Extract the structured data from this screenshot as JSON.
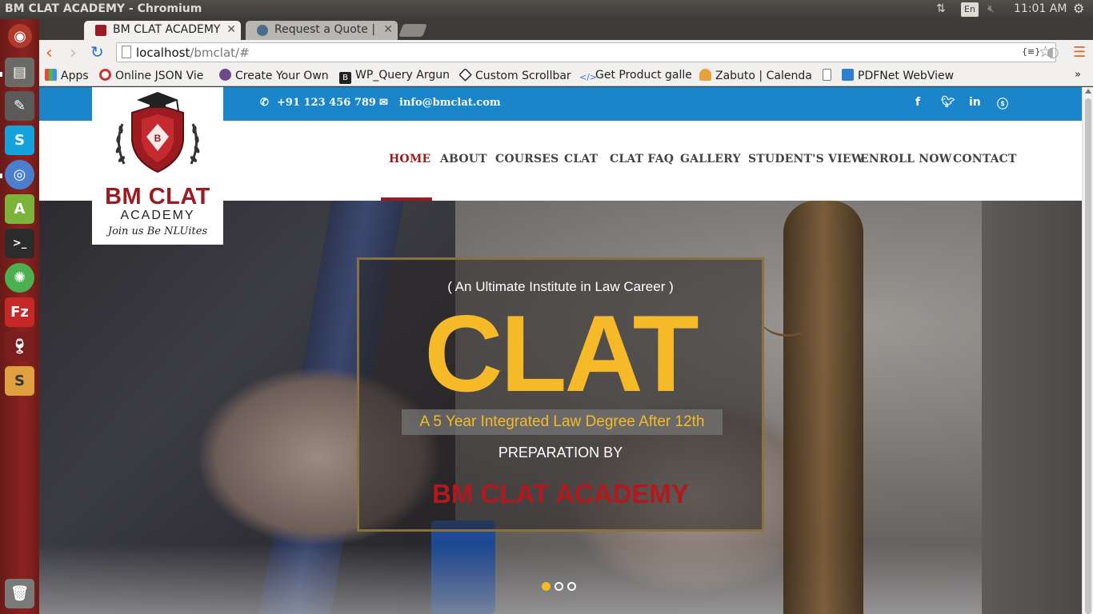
{
  "os": {
    "window_title": "BM CLAT ACADEMY - Chromium",
    "keyboard_layout": "En",
    "clock": "11:01 AM"
  },
  "browser": {
    "tabs": [
      {
        "title": "BM CLAT ACADEMY",
        "active": true
      },
      {
        "title": "Request a Quote | Tr",
        "active": false
      }
    ],
    "url_host": "localhost",
    "url_path": "/bmclat/#",
    "bookmarks": [
      {
        "label": "Apps",
        "icon": "apps-grid-icon"
      },
      {
        "label": "Online JSON Vie",
        "icon": "json-icon"
      },
      {
        "label": "Create Your Own",
        "icon": "feather-icon"
      },
      {
        "label": "WP_Query Argun",
        "icon": "b-icon"
      },
      {
        "label": "Custom Scrollbar",
        "icon": "codepen-icon"
      },
      {
        "label": "Get Product galle",
        "icon": "code-icon"
      },
      {
        "label": "Zabuto | Calenda",
        "icon": "calendar-icon"
      },
      {
        "label": "",
        "icon": "page-icon"
      },
      {
        "label": "PDFNet WebView",
        "icon": "pdfnet-icon"
      }
    ]
  },
  "site": {
    "phone": "+91 123 456 789",
    "email": "info@bmclat.com",
    "logo": {
      "name": "BM CLAT",
      "sub": "ACADEMY",
      "tagline": "Join us Be NLUites"
    },
    "nav": [
      "HOME",
      "ABOUT",
      "COURSES",
      "CLAT",
      "CLAT FAQ",
      "GALLERY",
      "STUDENT'S VIEW",
      "ENROLL NOW",
      "CONTACT"
    ],
    "hero": {
      "subtitle": "( An Ultimate Institute in Law Career )",
      "headline": "CLAT",
      "tagline": "A 5 Year Integrated Law Degree After 12th",
      "prep": "PREPARATION BY",
      "academy": "BM CLAT ACADEMY",
      "active_slide": 1,
      "slide_count": 3
    }
  },
  "colors": {
    "brand_red": "#9b1b20",
    "topbar_blue": "#1a85c8",
    "accent_gold": "#f6b928"
  }
}
